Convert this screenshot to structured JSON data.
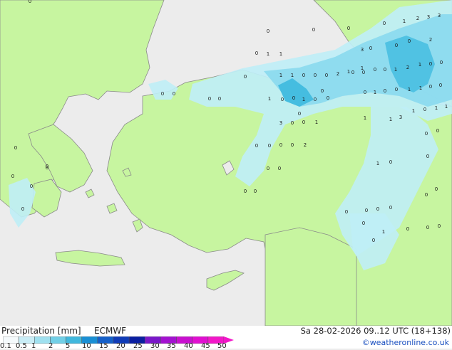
{
  "legend": {
    "title": "Precipitation [mm]",
    "model": "ECMWF",
    "valid": "Sa 28-02-2026 09..12 UTC (18+138)",
    "credit": "©weatheronline.co.uk",
    "ticks": [
      "0.1",
      "0.5",
      "1",
      "2",
      "5",
      "10",
      "15",
      "20",
      "25",
      "30",
      "35",
      "40",
      "45",
      "50"
    ],
    "colors": [
      "#f5fafc",
      "#c9edf6",
      "#9fe0ef",
      "#71cfe6",
      "#41b8dd",
      "#1a8fd4",
      "#1560c9",
      "#103cb7",
      "#0b1fa0",
      "#7a18c9",
      "#a312d0",
      "#c810cf",
      "#e00fd0",
      "#f218c8"
    ]
  },
  "colors": {
    "land": "#c7f5a0",
    "sea": "#ececec",
    "precip_light": "#bfeef6",
    "precip_mid": "#8ad9ee",
    "precip_heavy": "#45bde0",
    "coast": "#8a8a8a",
    "label": "#1a1a1a"
  },
  "map": {
    "labels": [
      "0",
      "0",
      "0",
      "1",
      "2",
      "3",
      "3",
      "0",
      "0",
      "0",
      "0",
      "1",
      "1",
      "3",
      "0",
      "0",
      "2",
      "1",
      "0",
      "0",
      "0",
      "1",
      "2",
      "1",
      "0",
      "0",
      "1",
      "1",
      "0",
      "0",
      "0",
      "2",
      "0",
      "1",
      "0",
      "1",
      "0",
      "0",
      "1",
      "1",
      "0",
      "0",
      "0",
      "0",
      "0",
      "0",
      "0",
      "1",
      "0",
      "0",
      "1",
      "0",
      "0",
      "1",
      "0",
      "1",
      "1",
      "3",
      "0",
      "0",
      "1",
      "1",
      "1",
      "3",
      "0",
      "0",
      "0",
      "0",
      "0",
      "0",
      "2",
      "1",
      "0",
      "0",
      "0",
      "0",
      "0",
      "0",
      "0",
      "0",
      "0",
      "0",
      "0",
      "1",
      "0",
      "0",
      "0",
      "0",
      "0",
      "0",
      "0",
      "0",
      "0",
      "0",
      "0",
      "0",
      "0",
      "0"
    ]
  }
}
